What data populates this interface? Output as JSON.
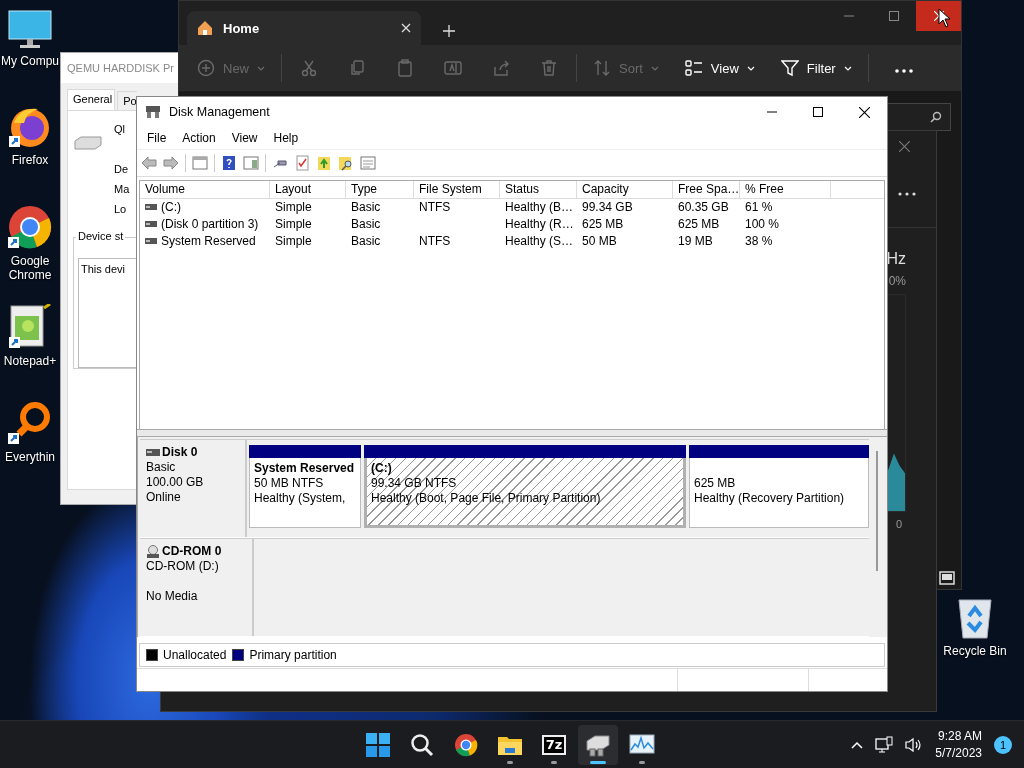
{
  "desktop_icons": [
    {
      "kind": "computer",
      "label": "My Compu"
    },
    {
      "kind": "firefox",
      "label": "Firefox"
    },
    {
      "kind": "chrome",
      "label": "Google Chrome"
    },
    {
      "kind": "notepad",
      "label": "Notepad+"
    },
    {
      "kind": "everything",
      "label": "Everythin"
    },
    {
      "kind": "recycle",
      "label": "Recycle Bin"
    }
  ],
  "properties_window": {
    "title": "QEMU HARDDISK Pr",
    "tabs": [
      {
        "label": "General",
        "selected": true
      },
      {
        "label": "Po",
        "selected": false
      }
    ],
    "labels": [
      "Ql",
      "De",
      "Ma",
      "Lo"
    ],
    "group_label": "Device st",
    "status_text": "This devi"
  },
  "explorer": {
    "tab": "Home",
    "toolbar": [
      {
        "kind": "new",
        "label": "New",
        "disabled": true
      },
      {
        "kind": "cut",
        "disabled": true
      },
      {
        "kind": "copy",
        "disabled": true
      },
      {
        "kind": "paste",
        "disabled": true
      },
      {
        "kind": "rename",
        "disabled": true
      },
      {
        "kind": "share",
        "disabled": true
      },
      {
        "kind": "delete",
        "disabled": true
      },
      {
        "kind": "sort",
        "label": "Sort",
        "disabled": true
      },
      {
        "kind": "view",
        "label": "View",
        "disabled": false
      },
      {
        "kind": "filter",
        "label": "Filter",
        "disabled": false
      }
    ]
  },
  "task_manager": {
    "unit": "Hz",
    "percent": "0%",
    "axis_min": "0"
  },
  "disk_management": {
    "title": "Disk Management",
    "menu": [
      "File",
      "Action",
      "View",
      "Help"
    ],
    "columns": [
      "Volume",
      "Layout",
      "Type",
      "File System",
      "Status",
      "Capacity",
      "Free Spa…",
      "% Free"
    ],
    "rows": [
      {
        "cells": [
          "(C:)",
          "Simple",
          "Basic",
          "NTFS",
          "Healthy (B…",
          "99.34 GB",
          "60.35 GB",
          "61 %"
        ]
      },
      {
        "cells": [
          "(Disk 0 partition 3)",
          "Simple",
          "Basic",
          "",
          "Healthy (R…",
          "625 MB",
          "625 MB",
          "100 %"
        ]
      },
      {
        "cells": [
          "System Reserved",
          "Simple",
          "Basic",
          "NTFS",
          "Healthy (S…",
          "50 MB",
          "19 MB",
          "38 %"
        ]
      }
    ],
    "disks": [
      {
        "kind": "disk",
        "name": "Disk 0",
        "lines": [
          "Basic",
          "100.00 GB",
          "Online"
        ],
        "partitions": [
          {
            "name": "System Reserved",
            "size": "50 MB NTFS",
            "status": "Healthy (System,",
            "selected": false
          },
          {
            "name": "(C:)",
            "size": "99.34 GB NTFS",
            "status": "Healthy (Boot, Page File, Primary Partition)",
            "selected": true
          },
          {
            "size": "625 MB",
            "status": "Healthy (Recovery Partition)",
            "selected": false
          }
        ]
      },
      {
        "kind": "cdrom",
        "name": "CD-ROM 0",
        "lines": [
          "CD-ROM (D:)",
          "No Media"
        ]
      }
    ],
    "legend": [
      {
        "label": "Unallocated",
        "color": "#000000"
      },
      {
        "label": "Primary partition",
        "color": "#000080"
      }
    ]
  },
  "taskbar": {
    "apps": [
      {
        "kind": "start",
        "running": false,
        "selected": false
      },
      {
        "kind": "search",
        "running": false,
        "selected": false
      },
      {
        "kind": "chrome",
        "running": false,
        "selected": false
      },
      {
        "kind": "folder",
        "running": true,
        "selected": false
      },
      {
        "kind": "archiver",
        "label": "7z",
        "running": true,
        "selected": false
      },
      {
        "kind": "disk",
        "running": true,
        "selected": true
      },
      {
        "kind": "monitor",
        "running": true,
        "selected": false
      }
    ],
    "time": "9:28 AM",
    "date": "5/7/2023",
    "notification_count": "1"
  }
}
